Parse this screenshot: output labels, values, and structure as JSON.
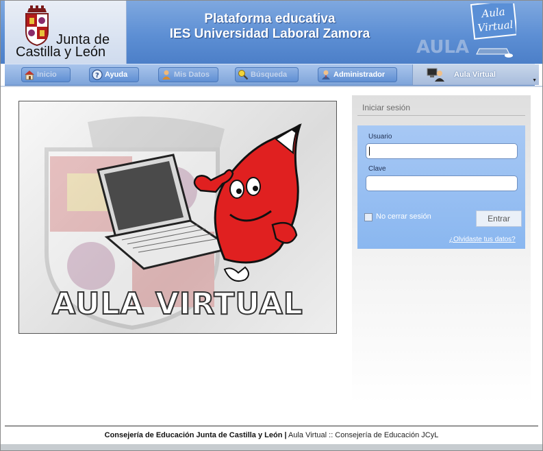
{
  "header": {
    "logo_line1": "Junta de",
    "logo_line2": "Castilla y León",
    "title_line1": "Plataforma educativa",
    "title_line2": "IES Universidad Laboral Zamora",
    "badge_word": "AULA",
    "badge_line1": "Aula",
    "badge_line2": "Virtual"
  },
  "nav": {
    "items": [
      {
        "label": "Inicio",
        "icon": "home-icon",
        "enabled": false
      },
      {
        "label": "Ayuda",
        "icon": "help-icon",
        "enabled": true
      },
      {
        "label": "Mis Datos",
        "icon": "user-icon",
        "enabled": false
      },
      {
        "label": "Búsqueda",
        "icon": "search-icon",
        "enabled": false
      },
      {
        "label": "Administrador",
        "icon": "admin-icon",
        "enabled": true
      }
    ],
    "active": {
      "label": "Aula Virtual",
      "icon": "computer-user-icon"
    }
  },
  "hero": {
    "title": "AULA VIRTUAL"
  },
  "login": {
    "title": "Iniciar sesión",
    "username_label": "Usuario",
    "username_value": "",
    "password_label": "Clave",
    "password_value": "",
    "remember_label": "No cerrar sesión",
    "remember_checked": false,
    "submit_label": "Entrar",
    "forgot_label": "¿Olvidaste tus datos?"
  },
  "footer": {
    "bold_text": "Consejería de Educación Junta de Castilla y León |",
    "plain_text": "Aula Virtual :: Consejería de Educación JCyL"
  },
  "colors": {
    "header_blue": "#5d8fd4",
    "nav_blue": "#7ea4da",
    "login_box": "#8ab7f0"
  }
}
